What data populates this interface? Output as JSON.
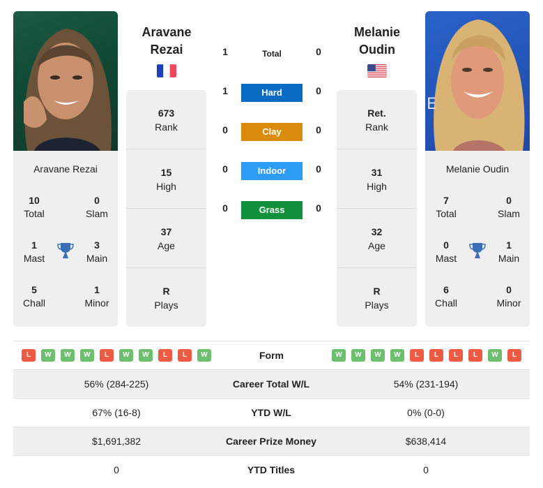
{
  "players": {
    "left": {
      "name_line1": "Aravane",
      "name_line2": "Rezai",
      "full_name": "Aravane Rezai",
      "country_flag": "france-flag",
      "stats": [
        {
          "value": "673",
          "label": "Rank"
        },
        {
          "value": "15",
          "label": "High"
        },
        {
          "value": "37",
          "label": "Age"
        },
        {
          "value": "R",
          "label": "Plays"
        }
      ],
      "titles": {
        "total": {
          "value": "10",
          "label": "Total"
        },
        "slam": {
          "value": "0",
          "label": "Slam"
        },
        "mast": {
          "value": "1",
          "label": "Mast"
        },
        "main": {
          "value": "3",
          "label": "Main"
        },
        "chall": {
          "value": "5",
          "label": "Chall"
        },
        "minor": {
          "value": "1",
          "label": "Minor"
        }
      },
      "form": [
        "L",
        "W",
        "W",
        "W",
        "L",
        "W",
        "W",
        "L",
        "L",
        "W"
      ]
    },
    "right": {
      "name_line1": "Melanie",
      "name_line2": "Oudin",
      "full_name": "Melanie Oudin",
      "country_flag": "usa-flag",
      "stats": [
        {
          "value": "Ret.",
          "label": "Rank"
        },
        {
          "value": "31",
          "label": "High"
        },
        {
          "value": "32",
          "label": "Age"
        },
        {
          "value": "R",
          "label": "Plays"
        }
      ],
      "titles": {
        "total": {
          "value": "7",
          "label": "Total"
        },
        "slam": {
          "value": "0",
          "label": "Slam"
        },
        "mast": {
          "value": "0",
          "label": "Mast"
        },
        "main": {
          "value": "1",
          "label": "Main"
        },
        "chall": {
          "value": "6",
          "label": "Chall"
        },
        "minor": {
          "value": "0",
          "label": "Minor"
        }
      },
      "form": [
        "W",
        "W",
        "W",
        "W",
        "L",
        "L",
        "L",
        "L",
        "W",
        "L"
      ]
    }
  },
  "h2h": [
    {
      "label": "Total",
      "left": "1",
      "right": "0",
      "color": ""
    },
    {
      "label": "Hard",
      "left": "1",
      "right": "0",
      "color": "#0a6bc4"
    },
    {
      "label": "Clay",
      "left": "0",
      "right": "0",
      "color": "#dc8c0c"
    },
    {
      "label": "Indoor",
      "left": "0",
      "right": "0",
      "color": "#2f9cf3"
    },
    {
      "label": "Grass",
      "left": "0",
      "right": "0",
      "color": "#12913c"
    }
  ],
  "form_label": "Form",
  "comparison": [
    {
      "label": "Career Total W/L",
      "left": "56% (284-225)",
      "right": "54% (231-194)"
    },
    {
      "label": "YTD W/L",
      "left": "67% (16-8)",
      "right": "0% (0-0)"
    },
    {
      "label": "Career Prize Money",
      "left": "$1,691,382",
      "right": "$638,414"
    },
    {
      "label": "YTD Titles",
      "left": "0",
      "right": "0"
    }
  ],
  "icons": {
    "trophy": "trophy-icon",
    "trophy_color": "#3a6fb8"
  }
}
